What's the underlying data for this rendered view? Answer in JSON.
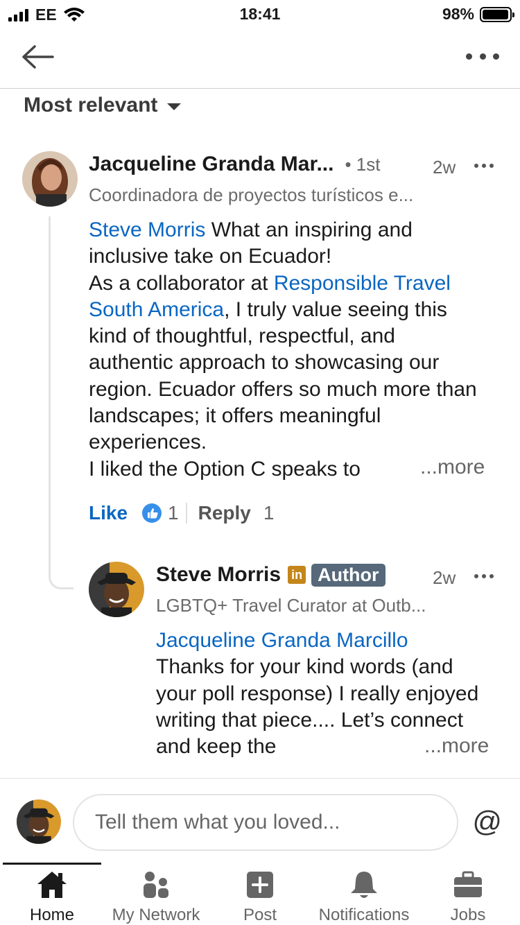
{
  "status_bar": {
    "carrier": "EE",
    "time": "18:41",
    "battery": "98%",
    "battery_level": 0.98
  },
  "sort": {
    "label": "Most relevant"
  },
  "comments": [
    {
      "name": "Jacqueline Granda Mar...",
      "degree": "• 1st",
      "time": "2w",
      "headline": "Coordinadora de proyectos turísticos e...",
      "mention": "Steve Morris",
      "text_1": " What an inspiring and inclusive take on Ecuador!",
      "text_2": "As a collaborator at ",
      "link": "Responsible Travel South America",
      "text_3": ", I truly value seeing this kind of thoughtful, respectful, and authentic approach to showcasing our region. Ecuador offers so much more than landscapes; it offers meaningful experiences.",
      "text_4": "I liked the Option C speaks to",
      "more": "...more",
      "like_label": "Like",
      "reaction_count": "1",
      "reply_label": "Reply",
      "reply_count": "1"
    },
    {
      "name": "Steve Morris",
      "badge_in": "in",
      "author_badge": "Author",
      "time": "2w",
      "headline": "LGBTQ+ Travel Curator at Outb...",
      "mention": "Jacqueline Granda Marcillo",
      "text": "Thanks for your kind words (and your poll response) I really enjoyed writing that piece.... Let’s connect and keep the",
      "more": "...more"
    }
  ],
  "composer": {
    "placeholder": "Tell them what you loved...",
    "mention_symbol": "@"
  },
  "tabs": [
    {
      "label": "Home",
      "icon": "home-icon"
    },
    {
      "label": "My Network",
      "icon": "network-icon"
    },
    {
      "label": "Post",
      "icon": "post-icon"
    },
    {
      "label": "Notifications",
      "icon": "bell-icon"
    },
    {
      "label": "Jobs",
      "icon": "briefcase-icon"
    }
  ]
}
